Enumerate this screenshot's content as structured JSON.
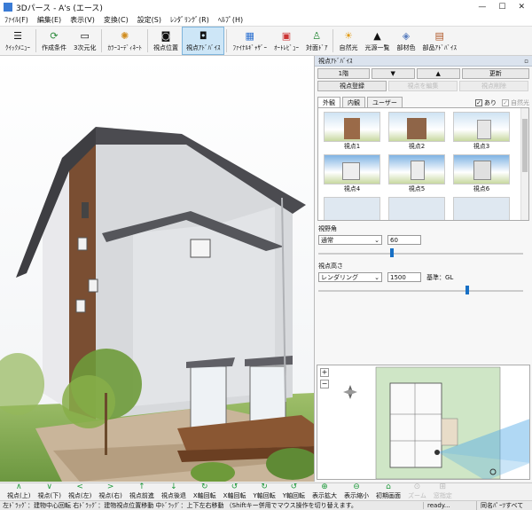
{
  "window": {
    "title": "3Dパース - A's (エース)",
    "minimize": "—",
    "maximize": "☐",
    "close": "✕"
  },
  "menu": [
    "ﾌｧｲﾙ(F)",
    "編集(E)",
    "表示(V)",
    "変換(C)",
    "設定(S)",
    "ﾚﾝﾀﾞﾘﾝｸﾞ(R)",
    "ﾍﾙﾌﾟ(H)"
  ],
  "toolbar": {
    "quick_menu": "ｸｲｯｸﾒﾆｭｰ",
    "create_cond": "作成条件",
    "to_3d": "3次元化",
    "color_coord": "ｶﾗｰｺｰﾃﾞｨﾈｰﾄ",
    "view_pos": "視点位置",
    "view_adv": "視点ｱﾄﾞﾊﾞｲｽ",
    "final_gather": "ﾌｧｲﾅﾙｷﾞｬｻﾞｰ",
    "auto_render": "ｵｰﾄﾚﾋﾞｭｰ",
    "target_door": "対面ﾄﾞｱ",
    "natural_light": "自然光",
    "light_list": "光源一覧",
    "room_color": "部材色",
    "parts_adv": "部品ｱﾄﾞﾊﾞｲｽ"
  },
  "panel": {
    "title": "視点ｱﾄﾞﾊﾞｲｽ",
    "pin": "▫",
    "floor": "1階",
    "down": "▼",
    "up": "▲",
    "update": "更新",
    "register": "視点登録",
    "edit": "視点を編集",
    "delete": "視点削除",
    "tabs": [
      "外観",
      "内観",
      "ユーザー"
    ],
    "with_check": "あり",
    "natural_check": "自然光",
    "thumbs": [
      "視点1",
      "視点2",
      "視点3",
      "視点4",
      "視点5",
      "視点6"
    ],
    "fov_label": "視野角",
    "fov_mode": "通常",
    "fov_value": "60",
    "height_label": "視点高さ",
    "height_mode": "レンダリング",
    "height_value": "1500",
    "height_base": "基準：GL",
    "fov_level": 0.35,
    "height_level": 0.72
  },
  "map": {
    "zoom_in": "+",
    "zoom_out": "−"
  },
  "bottom": [
    "視点(上)",
    "視点(下)",
    "視点(左)",
    "視点(右)",
    "視点前進",
    "視点後退",
    "X軸回転",
    "X軸回転",
    "Y軸回転",
    "Y軸回転",
    "表示拡大",
    "表示縮小",
    "初期画面",
    "ズーム",
    "窓指定"
  ],
  "bottom_icons": [
    "∧",
    "∨",
    "<",
    ">",
    "↑",
    "↓",
    "↻",
    "↺",
    "↻",
    "↺",
    "⊕",
    "⊖",
    "⌂",
    "⊙",
    "⊞"
  ],
  "status": {
    "hint": "左ﾄﾞﾗｯｸﾞ：建物中心回転  右ﾄﾞﾗｯｸﾞ：建物視点位置移動  中ﾄﾞﾗｯｸﾞ：上下左右移動  （Shiftキー併用でマウス操作を切り替えます。",
    "ready": "ready...",
    "parts": "同名ﾊﾟｰﾂすべて"
  }
}
